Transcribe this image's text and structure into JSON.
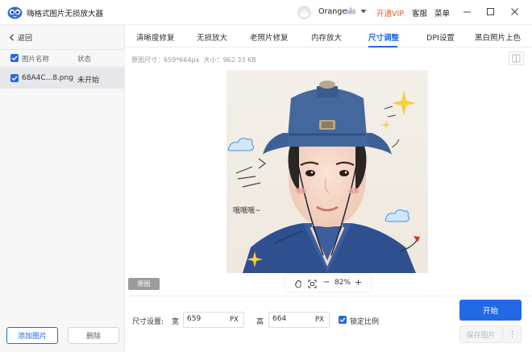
{
  "app": {
    "title": "嗨格式图片无损放大器",
    "user_name": "Orange",
    "vip_label": "开通VIP",
    "service_label": "客服",
    "menu_label": "菜单"
  },
  "sidebar": {
    "back_label": "返回",
    "col_name": "图片名称",
    "col_status": "状态",
    "files": [
      {
        "name": "68A4C...8.png",
        "status": "未开始"
      }
    ],
    "add_label": "添加图片",
    "delete_label": "删除"
  },
  "tabs": [
    {
      "label": "清晰度修复"
    },
    {
      "label": "无损放大"
    },
    {
      "label": "老照片修复"
    },
    {
      "label": "内存放大"
    },
    {
      "label": "尺寸调整"
    },
    {
      "label": "DPI设置"
    },
    {
      "label": "黑白照片上色"
    }
  ],
  "active_tab": "尺寸调整",
  "image_info": {
    "size_label": "原图尺寸：",
    "size_value": "659*664px",
    "file_label": "大小：",
    "file_value": "962.33 KB"
  },
  "preview": {
    "original_label": "原图",
    "zoom_level": "82%",
    "zoom_minus": "−",
    "zoom_plus": "+"
  },
  "settings": {
    "label": "尺寸设置:",
    "width_label": "宽",
    "width_value": "659",
    "width_unit": "PX",
    "height_label": "高",
    "height_value": "664",
    "height_unit": "PX",
    "lock_label": "锁定比例",
    "lock_checked": true
  },
  "actions": {
    "start_label": "开始",
    "save_label": "保存图片",
    "more_label": "⋮"
  },
  "colors": {
    "accent": "#2369e6",
    "vip": "#f35b22"
  }
}
